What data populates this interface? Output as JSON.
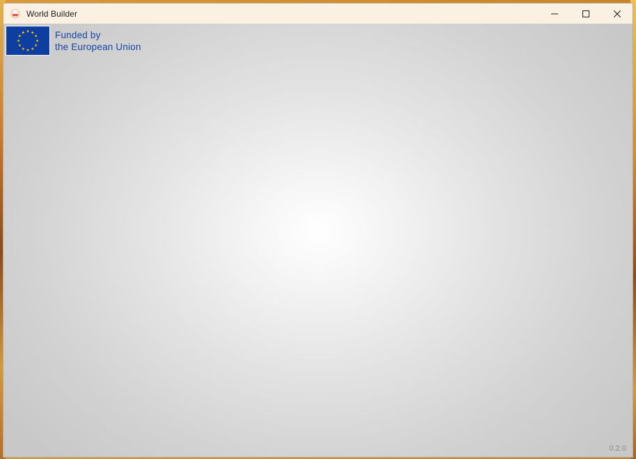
{
  "window": {
    "title": "World Builder",
    "app_icon": "app-icon",
    "controls": {
      "minimize_icon": "minimize-icon",
      "maximize_icon": "maximize-icon",
      "close_icon": "close-icon"
    }
  },
  "badge": {
    "flag_icon": "eu-flag-icon",
    "line1": "Funded by",
    "line2": "the European Union",
    "flag_color": "#0e3ea0",
    "star_color": "#ffcc00",
    "text_color": "#1744a5"
  },
  "footer": {
    "version": "0.2.0"
  }
}
